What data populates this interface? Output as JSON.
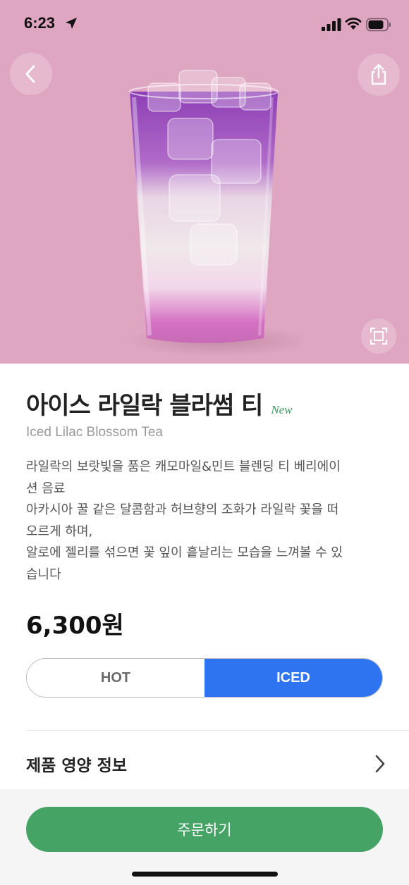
{
  "status_bar": {
    "time": "6:23"
  },
  "product": {
    "name_ko": "아이스 라일락 블라썸 티",
    "badge": "New",
    "name_en": "Iced Lilac Blossom Tea",
    "description_lines": [
      "라일락의 보랏빛을 품은 캐모마일&민트 블렌딩 티 베리에이",
      "션 음료",
      "아카시아 꿀 같은 달콤함과 허브향의 조화가 라일락 꽃을 떠",
      "오르게 하며,",
      "알로에 젤리를 섞으면 꽃 잎이 흩날리는 모습을 느껴볼 수 있",
      "습니다"
    ],
    "price": "6,300원"
  },
  "temperature": {
    "options": [
      "HOT",
      "ICED"
    ],
    "selected": "ICED"
  },
  "nutrition": {
    "label": "제품 영양 정보"
  },
  "order": {
    "label": "주문하기"
  },
  "colors": {
    "hero_bg": "#dfa6c2",
    "accent_blue": "#2e73f0",
    "order_green": "#46a366",
    "badge_green": "#3f9b65"
  },
  "icons": [
    "location-arrow-icon",
    "cellular-signal-icon",
    "wifi-icon",
    "battery-icon",
    "back-chevron-icon",
    "share-icon",
    "zoom-frame-icon",
    "chevron-right-icon"
  ]
}
